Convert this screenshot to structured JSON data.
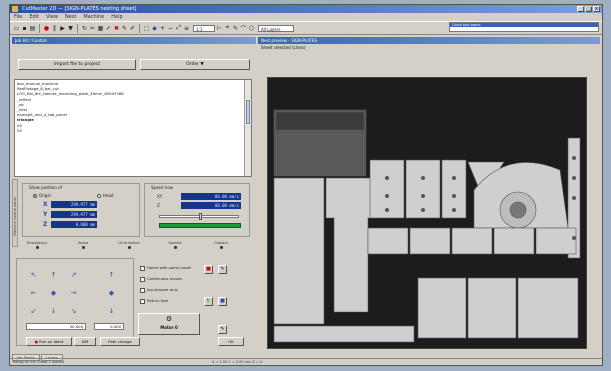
{
  "window": {
    "title": "CutMaster 2D — [SIGN-PLATES nesting sheet]"
  },
  "menu": [
    "File",
    "Edit",
    "View",
    "Nest",
    "Machine",
    "Help"
  ],
  "toolbar": {
    "combo_zoom": "1:1",
    "combo_layers": "All Layers"
  },
  "quick_panel": {
    "title": "Quick tool panel"
  },
  "left_panel": {
    "title": "Job list / Control",
    "import_button": "Import file to project",
    "order_button": "Order ▼",
    "files": [
      "box_manual_machine",
      "RedPlatage_8_bar_cut",
      "LOG_flat_file_cabinet_mounting_plate_49mm_80003368",
      "_reflect",
      "_nb",
      "_nest",
      "nameplt_rect_4_tab_panel",
      "triangle",
      "03",
      "04"
    ],
    "selected_file_index": 7,
    "side_tab": "Machine control panel",
    "position_group": "Show position of",
    "radio_origin": "Origin",
    "radio_head": "Head",
    "coords": [
      {
        "axis": "X",
        "value": "299.977 mm"
      },
      {
        "axis": "Y",
        "value": "299.977 mm"
      },
      {
        "axis": "Z",
        "value": "0.000 mm"
      }
    ],
    "speed_group": "Speed now",
    "speed_values": [
      "00.00 mm/s",
      "00.00 mm/s"
    ],
    "speed_labels": [
      "XY",
      "Z"
    ],
    "speed_slider_level": 0.5,
    "status_items": [
      "Emergency",
      "Home",
      "Limit switch",
      "Spindle",
      "Coolant"
    ],
    "jog_arrows": [
      "↖",
      "↑",
      "↗",
      "←",
      "◆",
      "→",
      "↙",
      "↓",
      "↘"
    ],
    "z_arrows": [
      "↑",
      "◆",
      "↓"
    ],
    "options": [
      "Home with same travel",
      "Continuous moves",
      "Jog sharper only",
      "Return fast"
    ],
    "field_a": "50.000",
    "field_b": "0.000",
    "motor_label": "Motor 0",
    "btn_stop": "Run on Ident",
    "btn_pause": "SIM",
    "btn_change": "Path change",
    "btn_ok": "OK",
    "tabs": [
      "Job Status",
      "Lasers"
    ]
  },
  "right_panel": {
    "title": "Nest preview - SIGN-PLATES",
    "subtitle": "Sheet selected (Lines)"
  },
  "status_bar": {
    "left": "Ready to cut: Sheet 1 loaded",
    "middle": "X = 1.00  Y = 0.00 mm  Z = 0"
  },
  "colors": {
    "accent": "#3a62b5",
    "display": "#14358a",
    "sheet": "#1c1c1c",
    "part": "#cfcfcf",
    "green": "#1e9a3a"
  }
}
